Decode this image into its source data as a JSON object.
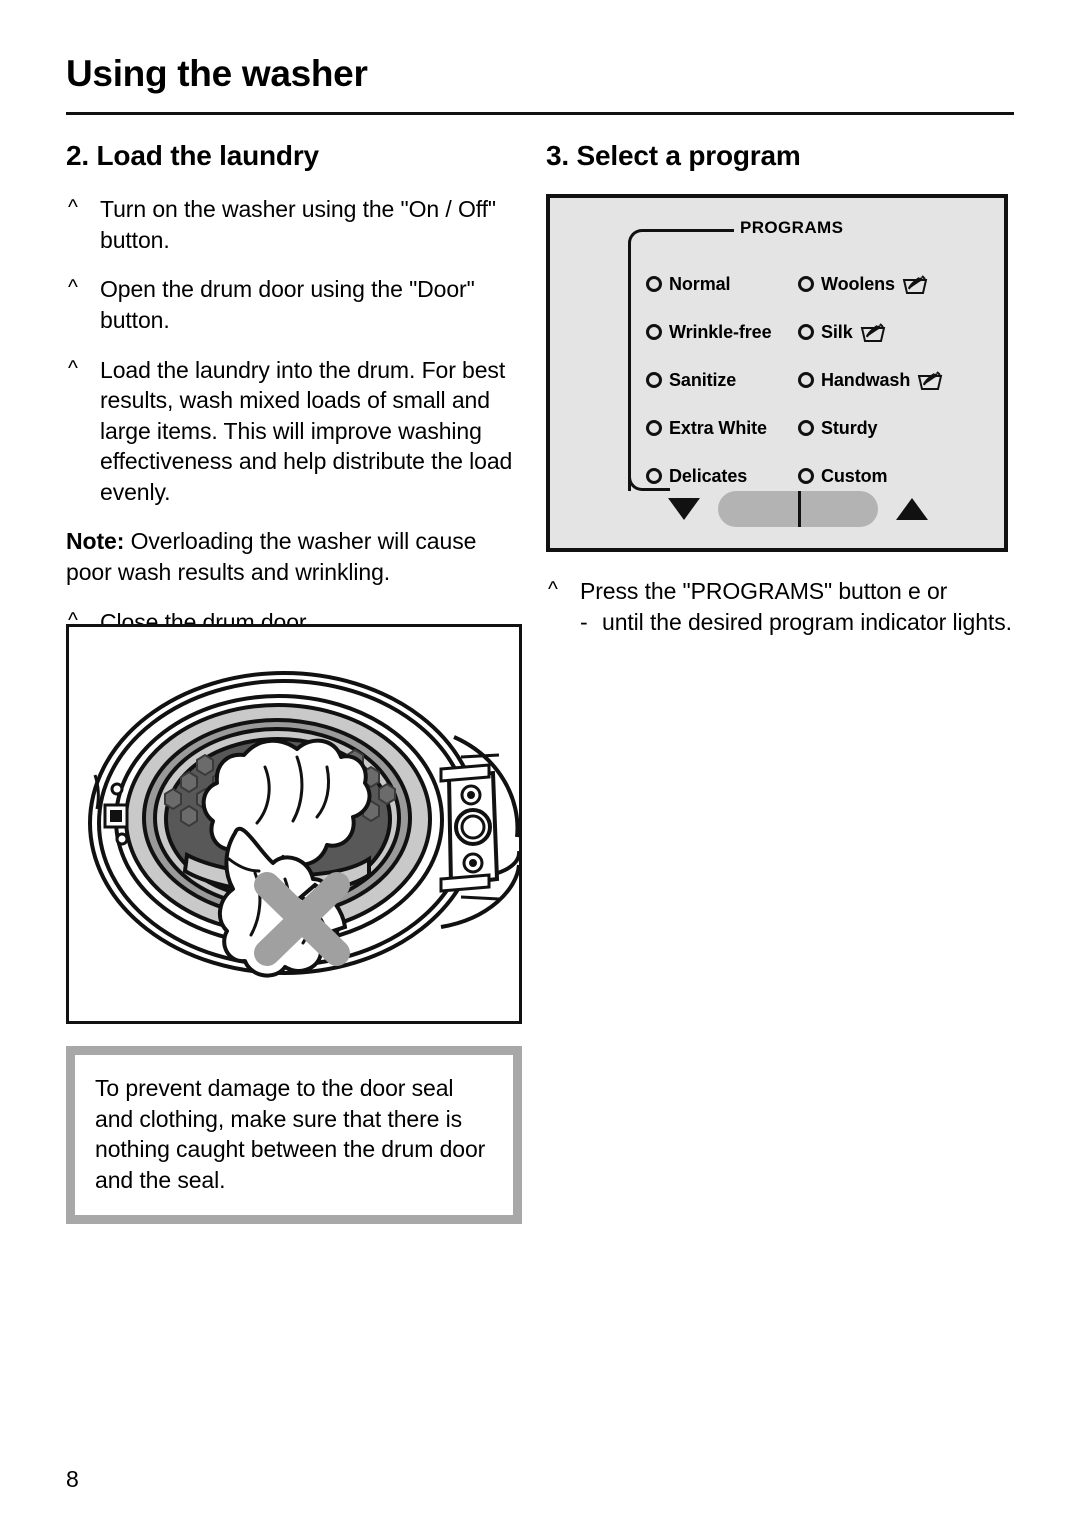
{
  "header": {
    "title": "Using the washer"
  },
  "left_column": {
    "heading": "2. Load the laundry",
    "bullets": [
      {
        "marker": "^",
        "text": "Turn on the washer using the \"On / Off\" button."
      },
      {
        "marker": "^",
        "text": "Open the drum door using the \"Door\" button."
      },
      {
        "marker": "^",
        "text": "Load the laundry into the drum. For best results, wash mixed loads of small and large items. This will improve washing effectiveness and help distribute the load evenly."
      }
    ],
    "note_label": "Note:",
    "note_text": " Overloading the washer will cause poor wash results and wrinkling.",
    "close_bullet": {
      "marker": "^",
      "text": "Close the drum door."
    },
    "figure_name": "washer-drum-door-open-with-laundry-caught",
    "warning_text": "To prevent damage to the door seal and clothing, make sure that there is nothing caught between the drum door and the seal."
  },
  "right_column": {
    "heading": "3. Select a program",
    "panel": {
      "label": "PROGRAMS",
      "programs": [
        [
          {
            "name": "Normal",
            "symbol": ""
          },
          {
            "name": "Woolens",
            "symbol": "handwash-tub-symbol"
          }
        ],
        [
          {
            "name": "Wrinkle-free",
            "symbol": ""
          },
          {
            "name": "Silk",
            "symbol": "handwash-tub-symbol"
          }
        ],
        [
          {
            "name": "Sanitize",
            "symbol": ""
          },
          {
            "name": "Handwash",
            "symbol": "handwash-tub-symbol"
          }
        ],
        [
          {
            "name": "Extra White",
            "symbol": ""
          },
          {
            "name": "Sturdy",
            "symbol": ""
          }
        ],
        [
          {
            "name": "Delicates",
            "symbol": ""
          },
          {
            "name": "Custom",
            "symbol": ""
          }
        ]
      ],
      "rocker": {
        "down_icon": "triangle-down-icon",
        "up_icon": "triangle-up-icon"
      }
    },
    "instruction": {
      "marker": "^",
      "line1": "Press the \"PROGRAMS\" button e  or",
      "dash": "-",
      "line2": "until the desired program indicator lights."
    }
  },
  "footer": {
    "page_number": "8"
  },
  "colors": {
    "ink": "#111111",
    "panel_fill": "#e4e4e4",
    "rocker_fill": "#b3b3b3",
    "warn_border": "#a8a8a8",
    "drum_dark": "#585858",
    "drum_mid": "#9a9a9a",
    "drum_light": "#c9c9c9"
  }
}
